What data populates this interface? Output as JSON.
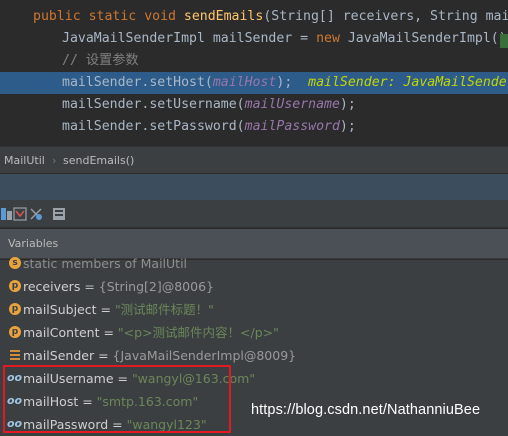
{
  "editor": {
    "line1": {
      "kw1": "public",
      "kw2": "static",
      "kw3": "void",
      "method": "sendEmails",
      "params": "(String[] receivers, String mailSub"
    },
    "line2": {
      "type": "JavaMailSenderImpl mailSender = ",
      "kw": "new",
      "rest": " JavaMailSenderImpl();"
    },
    "line3": {
      "comment": "// 设置参数"
    },
    "line4": {
      "call": "mailSender.setHost(",
      "arg": "mailHost",
      "end": ");",
      "inline": "mailSender: JavaMailSenderImp"
    },
    "line5": {
      "call": "mailSender.setUsername(",
      "arg": "mailUsername",
      "end": ");"
    },
    "line6": {
      "call": "mailSender.setPassword(",
      "arg": "mailPassword",
      "end": ");"
    }
  },
  "breadcrumb": {
    "class_name": "MailUtil",
    "method_name": "sendEmails()"
  },
  "debugger": {
    "toolbar_icons": [
      "frames-icon",
      "filter-icon",
      "breakpoint-icon",
      "restore-layout-icon"
    ]
  },
  "variables": {
    "title": "Variables",
    "rows": [
      {
        "icon": "static-icon",
        "name": "static",
        "eq": "",
        "value": "members of MailUtil",
        "kind": "static"
      },
      {
        "icon": "p",
        "name": "receivers",
        "eq": " = ",
        "value": "{String[2]@8006}",
        "kind": "obj"
      },
      {
        "icon": "p",
        "name": "mailSubject",
        "eq": " = ",
        "value": "\"测试邮件标题！\"",
        "kind": "str"
      },
      {
        "icon": "p",
        "name": "mailContent",
        "eq": " = ",
        "value": "\"<p>测试邮件内容！</p>\"",
        "kind": "str"
      },
      {
        "icon": "list",
        "name": "mailSender",
        "eq": " = ",
        "value": "{JavaMailSenderImpl@8009}",
        "kind": "obj"
      },
      {
        "icon": "oo",
        "name": "mailUsername",
        "eq": " = ",
        "value": "\"wangyl@163.com\"",
        "kind": "str"
      },
      {
        "icon": "oo",
        "name": "mailHost",
        "eq": " = ",
        "value": "\"smtp.163.com\"",
        "kind": "str"
      },
      {
        "icon": "oo",
        "name": "mailPassword",
        "eq": " = ",
        "value": "\"wangyl123\"",
        "kind": "str"
      }
    ]
  },
  "watermark": "https://blog.csdn.net/NathanniuBee",
  "colors": {
    "highlight": "#2d5c8a",
    "string": "#6a8759",
    "keyword": "#cc7832",
    "annotation_box": "#e01b24"
  }
}
